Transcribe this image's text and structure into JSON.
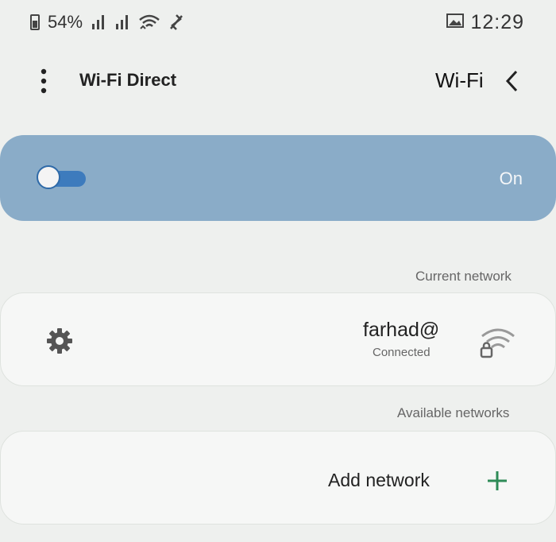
{
  "status_bar": {
    "time": "12:29",
    "battery_percent": "54%",
    "icons": [
      "battery-icon",
      "signal-icon",
      "signal-icon",
      "wifi-icon",
      "bluetooth-icon",
      "gallery-icon"
    ]
  },
  "header": {
    "title": "Wi-Fi",
    "wifi_direct": "Wi-Fi Direct",
    "icons": [
      "back-icon",
      "more-options-icon"
    ]
  },
  "master_switch": {
    "label": "On",
    "enabled": true,
    "accent_color": "#3d7bbd",
    "card_color": "#8aacc8"
  },
  "current_network": {
    "section_label": "Current network",
    "name": "farhad@",
    "status": "Connected",
    "icons": [
      "wifi-lock-icon",
      "gear-icon"
    ]
  },
  "available_networks": {
    "section_label": "Available networks",
    "add_label": "Add network",
    "add_icon_color": "#2e8b57"
  }
}
